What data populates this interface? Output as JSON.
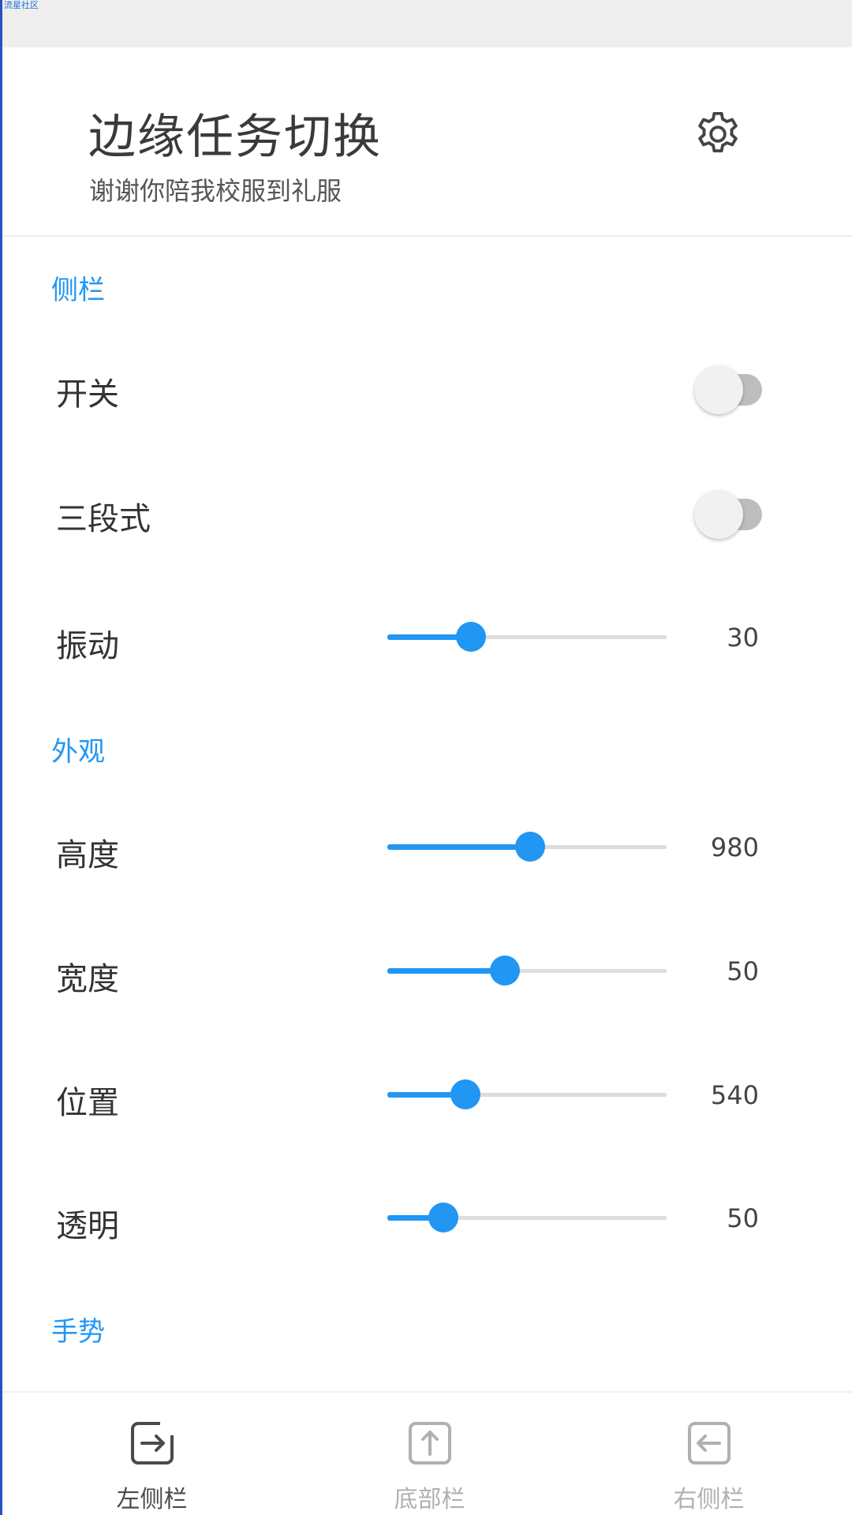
{
  "watermark": "流星社区",
  "header": {
    "title": "边缘任务切换",
    "subtitle": "谢谢你陪我校服到礼服",
    "settings_icon": "gear-icon"
  },
  "sections": {
    "sidebar": "侧栏",
    "appearance": "外观",
    "gesture": "手势"
  },
  "rows": {
    "switch": {
      "label": "开关",
      "on": false
    },
    "three_stage": {
      "label": "三段式",
      "on": false
    },
    "vibration": {
      "label": "振动",
      "value": "30",
      "level": 0.3
    },
    "height": {
      "label": "高度",
      "value": "980",
      "level": 0.51
    },
    "width": {
      "label": "宽度",
      "value": "50",
      "level": 0.42
    },
    "position": {
      "label": "位置",
      "value": "540",
      "level": 0.28
    },
    "opacity": {
      "label": "透明",
      "value": "50",
      "level": 0.2
    }
  },
  "bottom_nav": [
    {
      "label": "左侧栏",
      "icon": "left-sidebar-icon",
      "active": true
    },
    {
      "label": "底部栏",
      "icon": "bottom-bar-icon",
      "active": false
    },
    {
      "label": "右侧栏",
      "icon": "right-sidebar-icon",
      "active": false
    }
  ],
  "colors": {
    "accent": "#2196f3",
    "active_nav": "#4a4a4a",
    "inactive_nav": "#b0b0b0"
  }
}
